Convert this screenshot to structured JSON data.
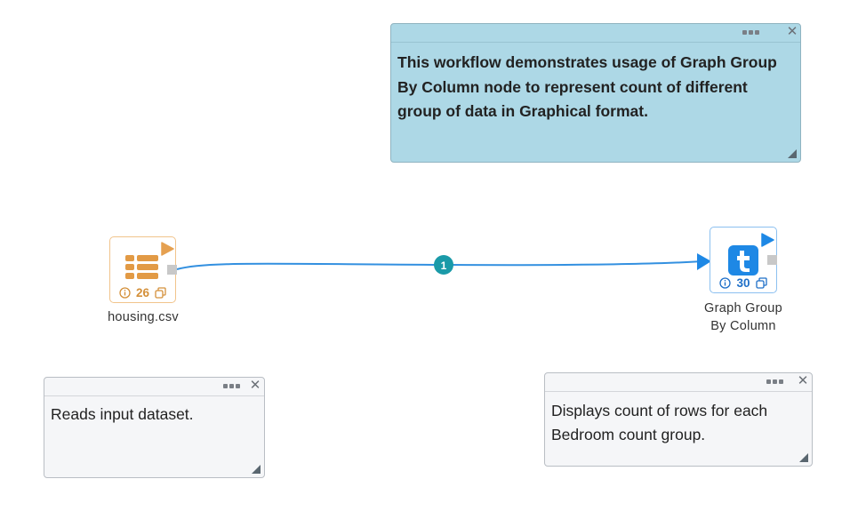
{
  "notes": {
    "description": {
      "text": "This workflow demonstrates usage of Graph Group By Column node to represent count of different group of data in Graphical format.",
      "bg_color": "#add8e6"
    },
    "reader": {
      "text": "Reads input dataset."
    },
    "grapher": {
      "text": "Displays count of rows for each Bedroom count group."
    },
    "close_glyph": "✕"
  },
  "nodes": {
    "reader": {
      "label": "housing.csv",
      "count": "26",
      "accent": "#e5a050",
      "icon": "table-list-icon"
    },
    "grapher": {
      "label_line1": "Graph Group",
      "label_line2": "By Column",
      "count": "30",
      "accent": "#1e88e5",
      "icon": "t-logo-icon"
    }
  },
  "connection": {
    "badge": "1",
    "badge_color": "#1a9aa8",
    "line_color": "#3390e0"
  }
}
